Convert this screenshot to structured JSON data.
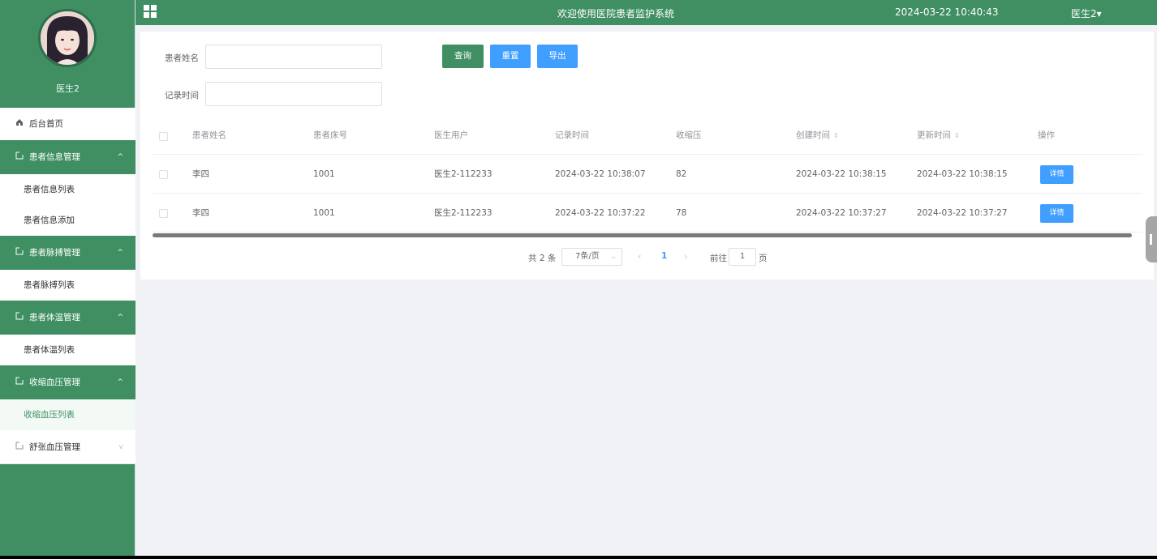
{
  "header": {
    "title": "欢迎使用医院患者监护系统",
    "datetime": "2024-03-22 10:40:43",
    "user": "医生2▾"
  },
  "sidebar": {
    "profile_name": "医生2",
    "home": "后台首页",
    "groups": [
      {
        "label": "患者信息管理",
        "chevron": "^",
        "items": [
          "患者信息列表",
          "患者信息添加"
        ]
      },
      {
        "label": "患者脉搏管理",
        "chevron": "^",
        "items": [
          "患者脉搏列表"
        ]
      },
      {
        "label": "患者体温管理",
        "chevron": "^",
        "items": [
          "患者体温列表"
        ]
      },
      {
        "label": "收缩血压管理",
        "chevron": "^",
        "items": [
          "收缩血压列表"
        ]
      },
      {
        "label": "舒张血压管理",
        "chevron": "v",
        "items": []
      }
    ]
  },
  "search": {
    "name_label": "患者姓名",
    "time_label": "记录时间",
    "query_btn": "查询",
    "reset_btn": "重置",
    "export_btn": "导出"
  },
  "table": {
    "columns": [
      "患者姓名",
      "患者床号",
      "医生用户",
      "记录时间",
      "收缩压",
      "创建时间",
      "更新时间",
      "操作"
    ],
    "sort_glyph": "⇕",
    "rows": [
      {
        "name": "李四",
        "bed": "1001",
        "doctor": "医生2-112233",
        "record_time": "2024-03-22 10:38:07",
        "systolic": "82",
        "created": "2024-03-22 10:38:15",
        "updated": "2024-03-22 10:38:15",
        "action": "详情"
      },
      {
        "name": "李四",
        "bed": "1001",
        "doctor": "医生2-112233",
        "record_time": "2024-03-22 10:37:22",
        "systolic": "78",
        "created": "2024-03-22 10:37:27",
        "updated": "2024-03-22 10:37:27",
        "action": "详情"
      }
    ]
  },
  "pagination": {
    "total": "共 2 条",
    "page_size": "7条/页",
    "prev": "‹",
    "current": "1",
    "next": "›",
    "goto_label": "前往",
    "goto_value": "1",
    "page_suffix": "页"
  },
  "icons": {
    "home": "home-icon",
    "menu": "document-icon",
    "grid": "grid-icon"
  },
  "colors": {
    "primary_green": "#3f8f63",
    "primary_blue": "#409eff"
  }
}
